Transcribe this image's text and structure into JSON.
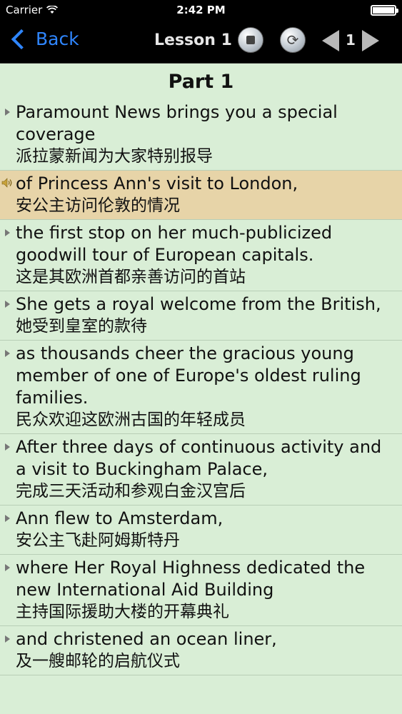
{
  "status": {
    "carrier": "Carrier",
    "time": "2:42 PM",
    "battery_level": 1.0
  },
  "nav": {
    "back_label": "Back",
    "lesson_title": "Lesson 1",
    "page_number": "1"
  },
  "section_title": "Part 1",
  "lines": [
    {
      "en": "Paramount News brings you a special coverage",
      "zh": "派拉蒙新闻为大家特别报导"
    },
    {
      "en": "of Princess Ann's visit to London,",
      "zh": "安公主访问伦敦的情况"
    },
    {
      "en": "the first stop on her much-publicized goodwill tour of European capitals.",
      "zh": "这是其欧洲首都亲善访问的首站"
    },
    {
      "en": "She gets a royal welcome from the British,",
      "zh": "她受到皇室的款待"
    },
    {
      "en": "as thousands cheer the gracious young member of one of Europe's oldest ruling families.",
      "zh": "民众欢迎这欧洲古国的年轻成员"
    },
    {
      "en": "After three days of continuous activity and a visit to Buckingham Palace,",
      "zh": "完成三天活动和参观白金汉宫后"
    },
    {
      "en": "Ann flew to Amsterdam,",
      "zh": "安公主飞赴阿姆斯特丹"
    },
    {
      "en": "where Her Royal Highness dedicated the new International Aid Building",
      "zh": "主持国际援助大楼的开幕典礼"
    },
    {
      "en": "and christened an ocean liner,",
      "zh": "及一艘邮轮的启航仪式"
    }
  ]
}
